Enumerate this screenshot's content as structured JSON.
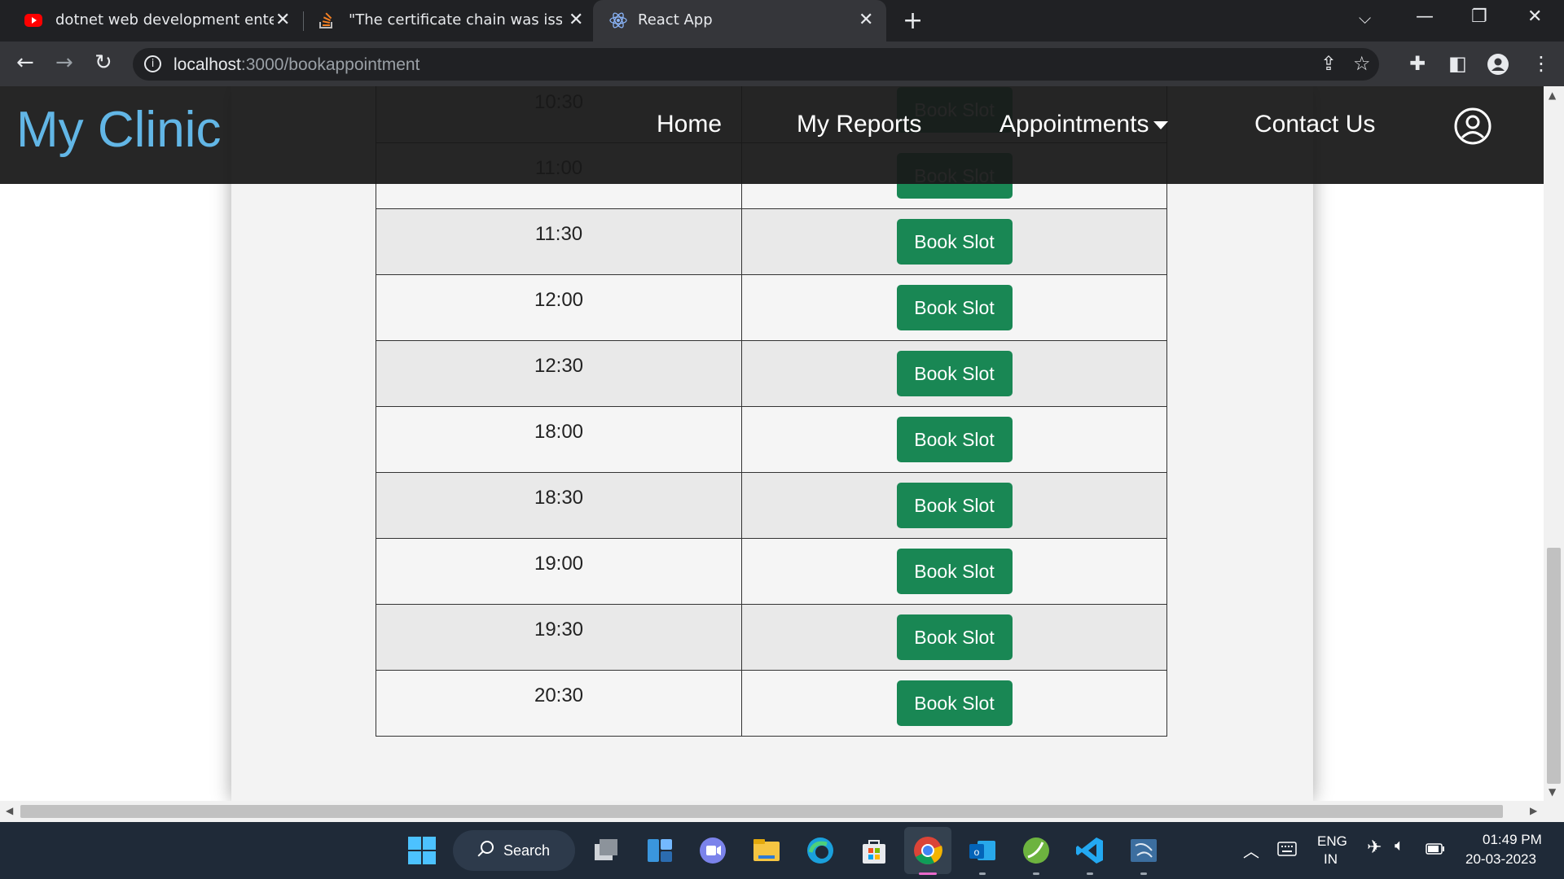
{
  "browser": {
    "tabs": [
      {
        "title": "dotnet web development enterpr",
        "icon": "youtube-icon"
      },
      {
        "title": "\"The certificate chain was issued",
        "icon": "stackoverflow-icon"
      },
      {
        "title": "React App",
        "icon": "react-icon",
        "active": true
      }
    ],
    "url_host": "localhost",
    "url_path": ":3000/bookappointment"
  },
  "site": {
    "brand": "My Clinic",
    "nav": {
      "home": "Home",
      "reports": "My Reports",
      "appointments": "Appointments",
      "contact": "Contact Us"
    }
  },
  "slots": [
    {
      "time": "10:30",
      "action": "Book Slot"
    },
    {
      "time": "11:00",
      "action": "Book Slot"
    },
    {
      "time": "11:30",
      "action": "Book Slot"
    },
    {
      "time": "12:00",
      "action": "Book Slot"
    },
    {
      "time": "12:30",
      "action": "Book Slot"
    },
    {
      "time": "18:00",
      "action": "Book Slot"
    },
    {
      "time": "18:30",
      "action": "Book Slot"
    },
    {
      "time": "19:00",
      "action": "Book Slot"
    },
    {
      "time": "19:30",
      "action": "Book Slot"
    },
    {
      "time": "20:30",
      "action": "Book Slot"
    }
  ],
  "taskbar": {
    "search_label": "Search",
    "lang_top": "ENG",
    "lang_bottom": "IN",
    "time": "01:49 PM",
    "date": "20-03-2023"
  },
  "colors": {
    "brand": "#62b6e6",
    "book_button": "#198754",
    "navbar": "#181818"
  }
}
